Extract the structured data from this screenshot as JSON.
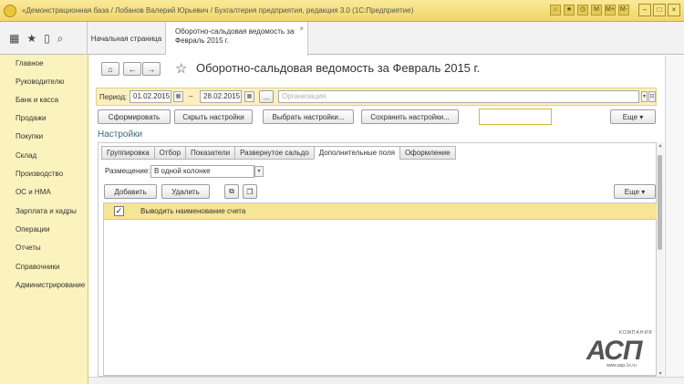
{
  "window": {
    "title": "«Демонстрационная база / Лобанов Валерий Юрьевич / Бухгалтерия предприятия, редакция 3.0 (1С:Предприятие)",
    "toolbar_icons": [
      "home-icon",
      "star-icon",
      "history-icon",
      "search-icon"
    ],
    "user_abbr": "М",
    "mem": "М+",
    "mem_minus": "М-"
  },
  "top": {
    "icons": [
      "grid-icon",
      "star-icon",
      "history-icon",
      "search-icon"
    ],
    "tab_home": "Начальная страница",
    "tab_report": "Оборотно-сальдовая ведомость за Февраль 2015 г.",
    "tab_close": "×"
  },
  "sidebar": {
    "items": [
      {
        "label": "Главное"
      },
      {
        "label": "Руководителю"
      },
      {
        "label": "Банк и касса"
      },
      {
        "label": "Продажи"
      },
      {
        "label": "Покупки"
      },
      {
        "label": "Склад"
      },
      {
        "label": "Производство"
      },
      {
        "label": "ОС и НМА"
      },
      {
        "label": "Зарплата и кадры"
      },
      {
        "label": "Операции"
      },
      {
        "label": "Отчеты"
      },
      {
        "label": "Справочники"
      },
      {
        "label": "Администрирование"
      }
    ]
  },
  "report": {
    "title": "Оборотно-сальдовая ведомость за Февраль 2015 г.",
    "period_label": "Период:",
    "date_from": "01.02.2015",
    "dash": "–",
    "date_to": "28.02.2015",
    "ellipsis": "...",
    "org_placeholder": "Организация",
    "buttons": {
      "generate": "Сформировать",
      "hide_settings": "Скрыть настройки",
      "choose_settings": "Выбрать настройки...",
      "save_settings": "Сохранить настройки...",
      "more": "Еще"
    }
  },
  "settings": {
    "title": "Настройки",
    "tabs": [
      {
        "label": "Группировка",
        "active": false
      },
      {
        "label": "Отбор",
        "active": false
      },
      {
        "label": "Показатели",
        "active": false
      },
      {
        "label": "Развернутое сальдо",
        "active": false
      },
      {
        "label": "Дополнительные поля",
        "active": true
      },
      {
        "label": "Оформление",
        "active": false
      }
    ],
    "placement_label": "Размещение:",
    "placement_value": "В одной колонке",
    "add": "Добавить",
    "delete": "Удалить",
    "more": "Еще",
    "rows": [
      {
        "checked": true,
        "label": "Выводить наименование счета"
      }
    ]
  },
  "logo": {
    "company": "КОМПАНИЯ",
    "brand": "АСП",
    "url": "www.asp-1c.ru"
  },
  "colors": {
    "sidebar_bg": "#fbf3bd",
    "titlebar_bg": "#f1d768",
    "selected_row": "#f7e596",
    "accent_text": "#3b6e78"
  }
}
